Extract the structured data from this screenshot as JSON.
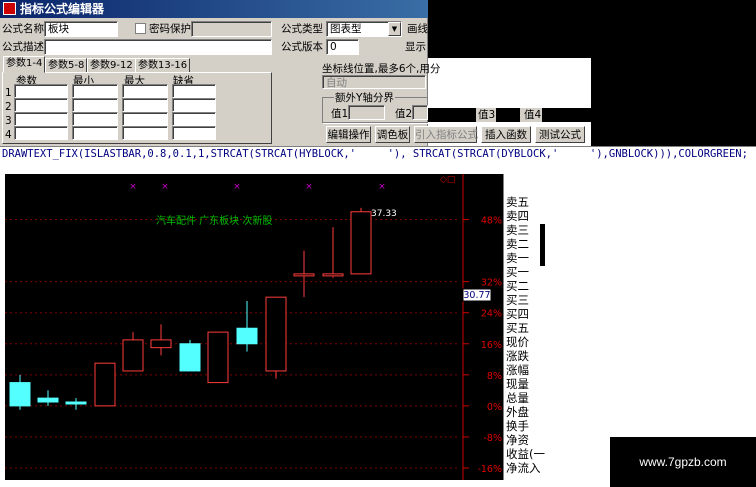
{
  "window": {
    "title": "指标公式编辑器",
    "formula_name_label": "公式名称",
    "formula_name_value": "板块",
    "password_label": "密码保护",
    "formula_type_label": "公式类型",
    "formula_type_value": "图表型",
    "draw_method_label": "画线",
    "formula_desc_label": "公式描述",
    "formula_desc_value": "",
    "formula_version_label": "公式版本",
    "formula_version_value": "0",
    "display_label": "显示",
    "tabs": [
      "参数1-4",
      "参数5-8",
      "参数9-12",
      "参数13-16"
    ],
    "param_headers": [
      "参数",
      "最小",
      "最大",
      "缺省"
    ],
    "param_rows": [
      "1",
      "2",
      "3",
      "4"
    ],
    "axis_hint": "坐标线位置,最多6个,用分",
    "axis_value": "自动",
    "extra_axis_group": "额外Y轴分界",
    "val1_label": "值1",
    "val2_label": "值2",
    "val3_label": "值3",
    "val4_label": "值4",
    "buttons": {
      "edit": "编辑操作",
      "palette": "调色板",
      "import": "引入指标公式",
      "insert_func": "插入函数",
      "test": "测试公式"
    }
  },
  "formula": {
    "code": "DRAWTEXT_FIX(ISLASTBAR,0.8,0.1,1,STRCAT(STRCAT(HYBLOCK,'     '), STRCAT(STRCAT(DYBLOCK,'     '),GNBLOCK))),COLORGREEN;"
  },
  "chart": {
    "block_text": "汽车配件  广东板块  次新股",
    "price_label": "37.33",
    "current_price": "30.77",
    "y_ticks": [
      "48%",
      "32%",
      "24%",
      "16%",
      "8%",
      "0%",
      "-8%",
      "-16%"
    ],
    "markers": [
      "×",
      "×",
      "×",
      "×",
      "×"
    ],
    "corner_label": "◇□"
  },
  "chart_data": {
    "type": "candlestick",
    "ylim": [
      -16,
      52
    ],
    "y_unit": "%",
    "tick_values": [
      48,
      32,
      24,
      16,
      8,
      0,
      -8,
      -16
    ],
    "candles": [
      {
        "o": 0,
        "c": 6,
        "h": 8,
        "l": -1,
        "up": false
      },
      {
        "o": 2,
        "c": 1,
        "h": 4,
        "l": 0,
        "up": false
      },
      {
        "o": 1,
        "c": 1,
        "h": 2,
        "l": -1,
        "up": false
      },
      {
        "o": 0,
        "c": 11,
        "h": 11,
        "l": 0,
        "up": true
      },
      {
        "o": 9,
        "c": 17,
        "h": 19,
        "l": 9,
        "up": true
      },
      {
        "o": 17,
        "c": 15,
        "h": 21,
        "l": 13,
        "up": true
      },
      {
        "o": 9,
        "c": 16,
        "h": 17,
        "l": 9,
        "up": false
      },
      {
        "o": 6,
        "c": 19,
        "h": 19,
        "l": 6,
        "up": true
      },
      {
        "o": 16,
        "c": 20,
        "h": 27,
        "l": 14,
        "up": false
      },
      {
        "o": 9,
        "c": 28,
        "h": 28,
        "l": 7,
        "up": true
      },
      {
        "o": 34,
        "c": 34,
        "h": 40,
        "l": 28,
        "up": true
      },
      {
        "o": 34,
        "c": 34,
        "h": 46,
        "l": 33,
        "up": true
      },
      {
        "o": 34,
        "c": 50,
        "h": 51,
        "l": 34,
        "up": true
      }
    ]
  },
  "right_panel": {
    "items": [
      "卖五",
      "卖四",
      "卖三",
      "卖二",
      "卖一",
      "买一",
      "买二",
      "买三",
      "买四",
      "买五",
      "现价",
      "涨跌",
      "涨幅",
      "现量",
      "总量",
      "外盘",
      "换手",
      "净资",
      "收益(一",
      "净流入"
    ]
  },
  "watermark": {
    "text": "www.7gpzb.com"
  }
}
